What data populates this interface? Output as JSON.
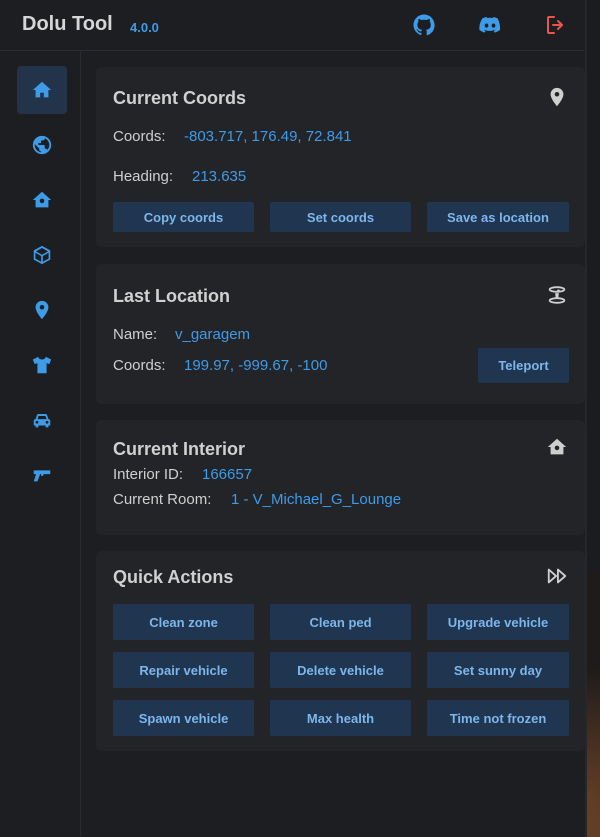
{
  "app": {
    "title": "Dolu Tool",
    "version": "4.0.0"
  },
  "header": {
    "icons": [
      "github-icon",
      "discord-icon",
      "exit-icon"
    ],
    "exit_color": "#e8574e",
    "accent": "#3d9be8"
  },
  "sidebar": {
    "items": [
      {
        "icon": "home-icon",
        "active": true
      },
      {
        "icon": "globe-icon",
        "active": false
      },
      {
        "icon": "house-icon",
        "active": false
      },
      {
        "icon": "cube-icon",
        "active": false
      },
      {
        "icon": "map-pin-icon",
        "active": false
      },
      {
        "icon": "shirt-icon",
        "active": false
      },
      {
        "icon": "car-icon",
        "active": false
      },
      {
        "icon": "gun-icon",
        "active": false
      }
    ]
  },
  "current_coords": {
    "title": "Current Coords",
    "coords_label": "Coords:",
    "coords_value": "-803.717, 176.49, 72.841",
    "heading_label": "Heading:",
    "heading_value": "213.635",
    "buttons": {
      "copy": "Copy coords",
      "set": "Set coords",
      "save": "Save as location"
    }
  },
  "last_location": {
    "title": "Last Location",
    "name_label": "Name:",
    "name_value": "v_garagem",
    "coords_label": "Coords:",
    "coords_value": "199.97, -999.67, -100",
    "teleport_button": "Teleport"
  },
  "current_interior": {
    "title": "Current Interior",
    "id_label": "Interior ID:",
    "id_value": "166657",
    "room_label": "Current Room:",
    "room_value": "1 - V_Michael_G_Lounge"
  },
  "quick_actions": {
    "title": "Quick Actions",
    "buttons": [
      "Clean zone",
      "Clean ped",
      "Upgrade vehicle",
      "Repair vehicle",
      "Delete vehicle",
      "Set sunny day",
      "Spawn vehicle",
      "Max health",
      "Time not frozen"
    ]
  }
}
